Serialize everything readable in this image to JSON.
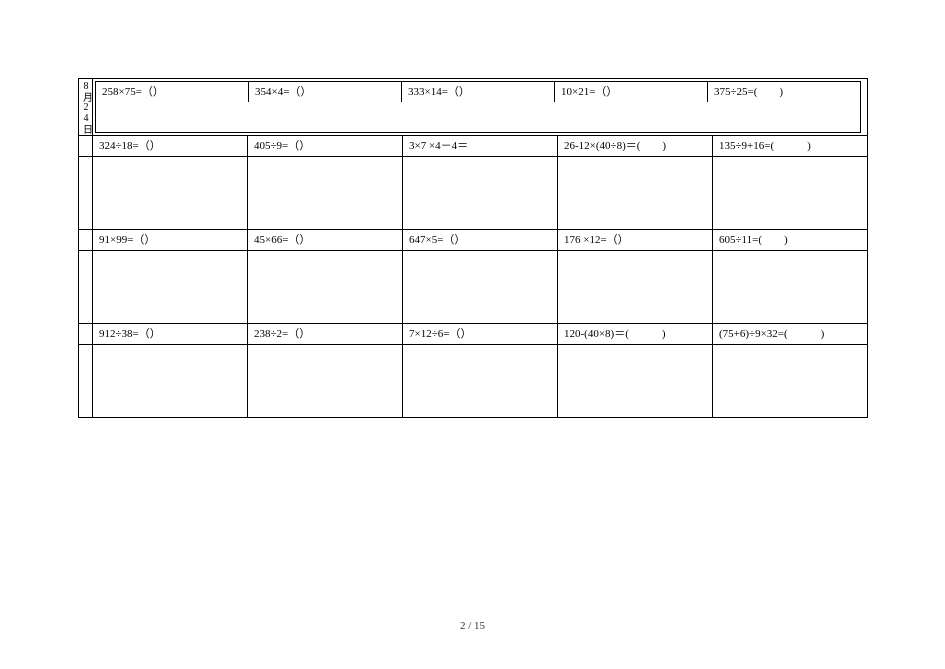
{
  "date_label": "8月24日",
  "rows": [
    {
      "kind": "eq-highlight",
      "cells": [
        "258×75=（）",
        "354×4=（）",
        "333×14=（）",
        "10×21=（）",
        "375÷25=(　　)"
      ]
    },
    {
      "kind": "work",
      "cells": [
        "",
        "",
        "",
        "",
        ""
      ]
    },
    {
      "kind": "eq",
      "cells": [
        "324÷18=（）",
        "405÷9=（）",
        "3×7 ×4－4＝",
        "26-12×(40÷8)＝(　　)",
        "135÷9+16=(　　　)"
      ]
    },
    {
      "kind": "work",
      "cells": [
        "",
        "",
        "",
        "",
        ""
      ]
    },
    {
      "kind": "eq",
      "cells": [
        "91×99=（）",
        "45×66=（）",
        "647×5=（）",
        "176 ×12=（）",
        "605÷11=(　　)"
      ]
    },
    {
      "kind": "work",
      "cells": [
        "",
        "",
        "",
        "",
        ""
      ]
    },
    {
      "kind": "eq",
      "cells": [
        "912÷38=（）",
        "238÷2=（）",
        "7×12÷6=（）",
        "120-(40×8)＝(　　　)",
        "(75+6)÷9×32=(　　　)"
      ]
    },
    {
      "kind": "work",
      "cells": [
        "",
        "",
        "",
        "",
        ""
      ]
    }
  ],
  "page_number": "2 / 15"
}
